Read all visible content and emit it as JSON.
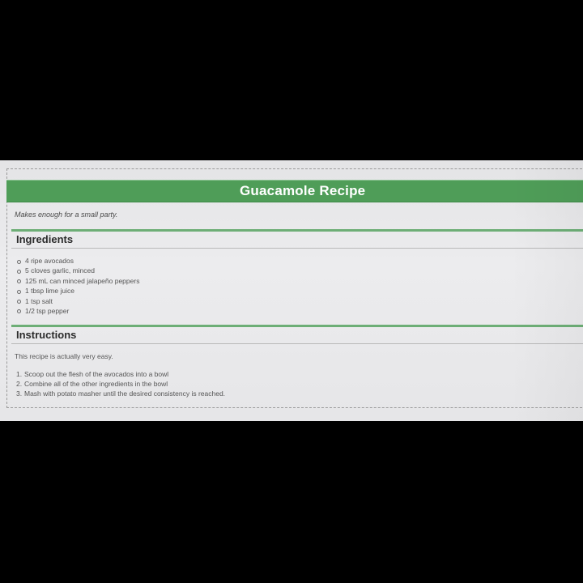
{
  "page": {
    "title": "Guacamole Recipe",
    "tagline": "Makes enough for a small party."
  },
  "ingredients": {
    "heading": "Ingredients",
    "items": [
      "4 ripe avocados",
      "5 cloves garlic, minced",
      "125 mL can minced jalapeño peppers",
      "1 tbsp lime juice",
      "1 tsp salt",
      "1/2 tsp pepper"
    ]
  },
  "instructions": {
    "heading": "Instructions",
    "intro": "This recipe is actually very easy.",
    "steps": [
      {
        "num": "1.",
        "text": "Scoop out the flesh of the avocados into a bowl"
      },
      {
        "num": "2.",
        "text": "Combine all of the other ingredients in the bowl"
      },
      {
        "num": "3.",
        "text": "Mash with potato masher until the desired consistency is reached."
      }
    ]
  },
  "colors": {
    "title_bar": "#4f9d58",
    "section_rule": "#6dae76",
    "page_background": "#e8e8ea",
    "surround": "#000000"
  }
}
